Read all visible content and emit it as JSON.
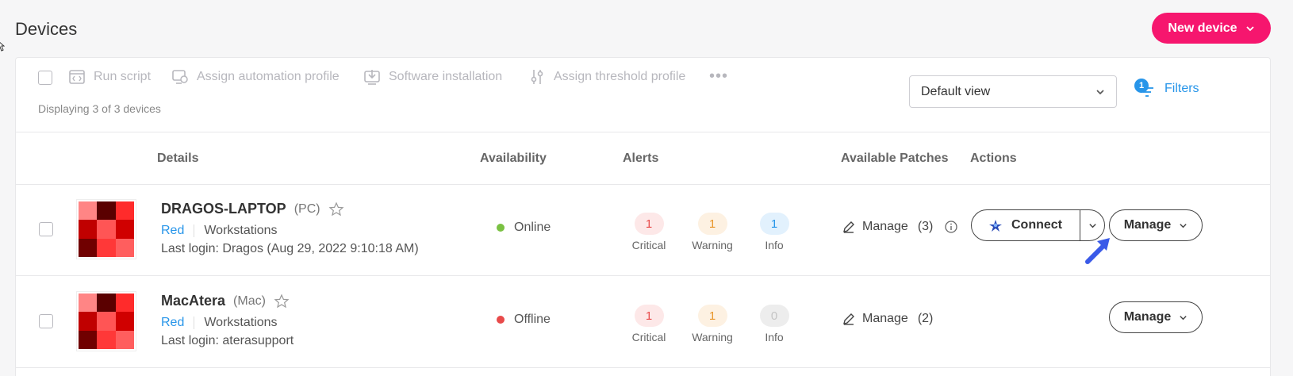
{
  "header": {
    "title": "Devices",
    "new_device_label": "New device"
  },
  "colors": {
    "brand": "#f6166e",
    "link": "#2795e9",
    "online": "#7ac142",
    "offline": "#e84a4a"
  },
  "toolbar": {
    "run_script": "Run script",
    "assign_automation": "Assign automation profile",
    "software_installation": "Software installation",
    "assign_threshold": "Assign threshold profile",
    "more": "•••",
    "displaying": "Displaying 3 of 3 devices",
    "view_select": "Default view",
    "filters_label": "Filters",
    "filters_count": "1"
  },
  "columns": {
    "details": "Details",
    "availability": "Availability",
    "alerts": "Alerts",
    "patches": "Available Patches",
    "actions": "Actions"
  },
  "devices": [
    {
      "name": "DRAGOS-LAPTOP",
      "type": "(PC)",
      "customer": "Red",
      "group": "Workstations",
      "last_login": "Last login: Dragos (Aug 29, 2022 9:10:18 AM)",
      "status": "Online",
      "alerts": {
        "critical": "1",
        "warning": "1",
        "info": "1"
      },
      "patches_label": "Manage",
      "patches_count": "(3)",
      "connect_label": "Connect",
      "manage_label": "Manage"
    },
    {
      "name": "MacAtera",
      "type": "(Mac)",
      "customer": "Red",
      "group": "Workstations",
      "last_login": "Last login: aterasupport",
      "status": "Offline",
      "alerts": {
        "critical": "1",
        "warning": "1",
        "info": "0"
      },
      "patches_label": "Manage",
      "patches_count": "(2)",
      "manage_label": "Manage"
    }
  ],
  "alert_labels": {
    "critical": "Critical",
    "warning": "Warning",
    "info": "Info"
  }
}
